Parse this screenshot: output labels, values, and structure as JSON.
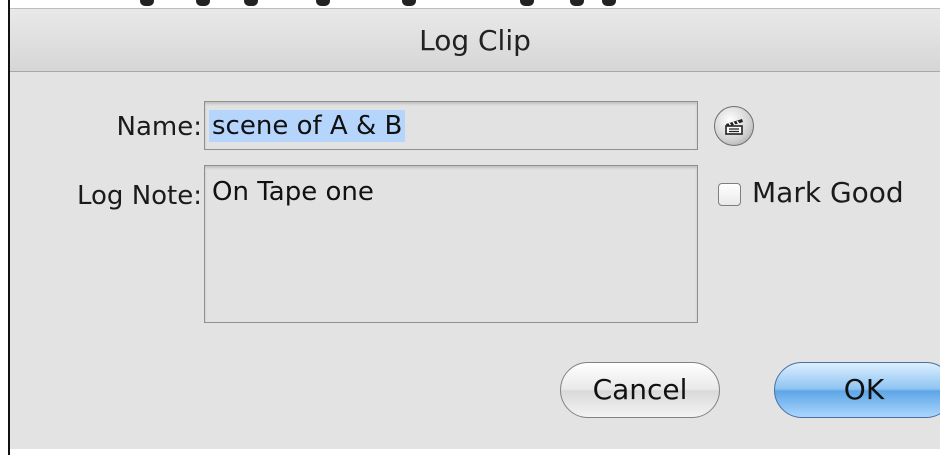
{
  "dialog": {
    "title": "Log Clip",
    "name_label": "Name:",
    "name_value": "scene of A & B",
    "note_label": "Log Note:",
    "note_value": "On Tape one",
    "mark_good_label": "Mark Good",
    "mark_good_checked": false,
    "cancel_label": "Cancel",
    "ok_label": "OK",
    "clapper_icon": "clapperboard-icon"
  },
  "colors": {
    "selection": "#b6d5fd",
    "default_button": "#5ea6e6",
    "dialog_bg": "#e3e3e3"
  }
}
